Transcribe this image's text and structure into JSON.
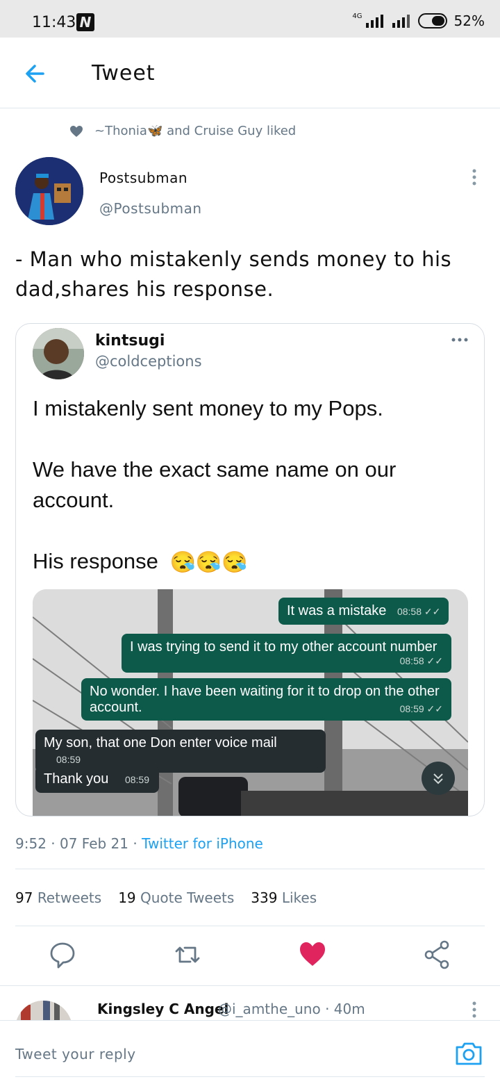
{
  "status_bar": {
    "time": "11:43",
    "notification_icon": "n-icon",
    "network": "4G",
    "battery": "52%"
  },
  "header": {
    "title": "Tweet",
    "back_icon": "arrow-left-icon"
  },
  "social_context": {
    "text": "~Thonia🦋 and Cruise Guy liked"
  },
  "tweet": {
    "author_name": "Postsubman",
    "author_handle": "@Postsubman",
    "text": "- Man who mistakenly sends money to his dad,shares his response.",
    "timestamp": "9:52 · 07 Feb 21 · ",
    "source": "Twitter for iPhone",
    "stats": {
      "retweets_count": "97",
      "retweets_label": "Retweets",
      "quotes_count": "19",
      "quotes_label": "Quote Tweets",
      "likes_count": "339",
      "likes_label": "Likes"
    },
    "liked": true
  },
  "quoted_tweet": {
    "name": "kintsugi",
    "handle": "@coldceptions",
    "line1": "I mistakenly sent money to my Pops.",
    "line2": "We have the exact same name on our account.",
    "line3": "His response",
    "emoji": "😪😪😪"
  },
  "chat_messages": [
    {
      "text": "It was a mistake",
      "time": "08:58 ✓✓",
      "direction": "out"
    },
    {
      "text": "I was trying to send it to my other account number",
      "time": "08:58 ✓✓",
      "direction": "out"
    },
    {
      "text": "No wonder. I have been waiting for it to drop on the other account.",
      "time": "08:59 ✓✓",
      "direction": "out"
    },
    {
      "text": "My son, that one Don enter voice mail",
      "time": "08:59",
      "direction": "in"
    },
    {
      "text": "Thank you",
      "time": "08:59",
      "direction": "in"
    }
  ],
  "reply_preview": {
    "name": "Kingsley C Angel",
    "handle_time": "@i_amthe_uno · 40m"
  },
  "compose": {
    "placeholder": "Tweet your reply"
  },
  "colors": {
    "accent": "#1da1f2",
    "like": "#e0245e",
    "muted": "#657786",
    "chat_outgoing": "#0d5a4a",
    "chat_incoming": "#252d31"
  }
}
